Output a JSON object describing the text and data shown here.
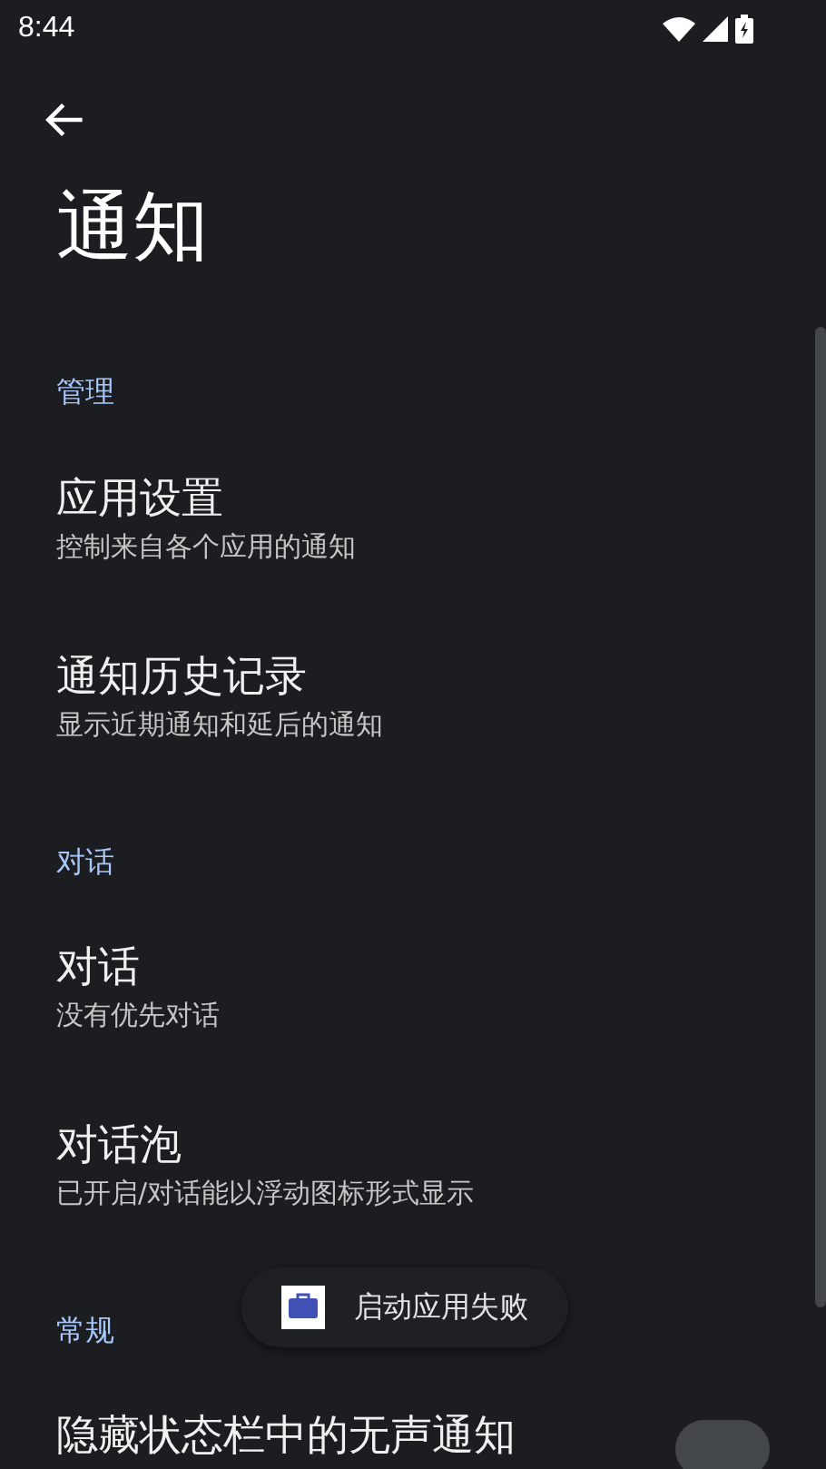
{
  "status_bar": {
    "time": "8:44"
  },
  "title": "通知",
  "sections": [
    {
      "header": "管理",
      "items": [
        {
          "title": "应用设置",
          "subtitle": "控制来自各个应用的通知"
        },
        {
          "title": "通知历史记录",
          "subtitle": "显示近期通知和延后的通知"
        }
      ]
    },
    {
      "header": "对话",
      "items": [
        {
          "title": "对话",
          "subtitle": "没有优先对话"
        },
        {
          "title": "对话泡",
          "subtitle": "已开启/对话能以浮动图标形式显示"
        }
      ]
    },
    {
      "header": "常规",
      "items": [
        {
          "title": "隐藏状态栏中的无声通知",
          "kind": "toggle",
          "on": false
        }
      ]
    }
  ],
  "toast": {
    "text": "启动应用失败"
  }
}
